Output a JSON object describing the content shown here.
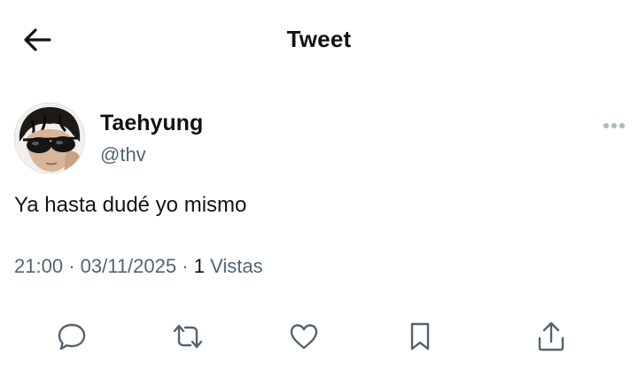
{
  "header": {
    "title": "Tweet",
    "back_icon": "arrow-left-icon"
  },
  "author": {
    "name": "Taehyung",
    "handle": "@thv"
  },
  "more_icon": "more-horizontal-icon",
  "tweet": {
    "text": "Ya hasta dudé yo mismo"
  },
  "meta": {
    "time": "21:00",
    "separator": "·",
    "date": "03/11/2025",
    "views_count": "1",
    "views_label": "Vistas"
  },
  "actions": {
    "icons": [
      "reply-icon",
      "retweet-icon",
      "like-icon",
      "bookmark-icon",
      "share-icon"
    ]
  },
  "colors": {
    "text_primary": "#0f1419",
    "text_secondary": "#536471",
    "icon": "#536471",
    "more_dots": "#aab8c2"
  }
}
